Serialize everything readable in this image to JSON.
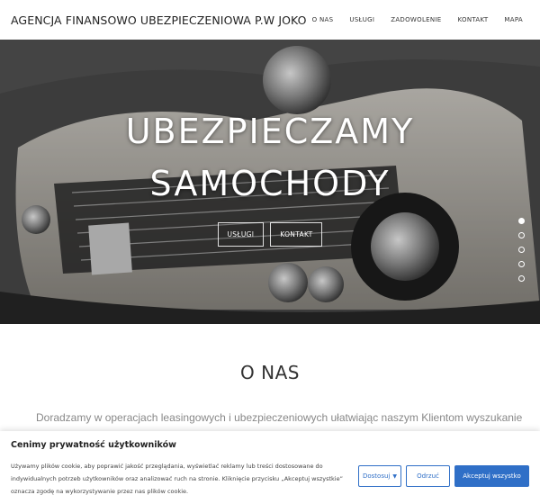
{
  "header": {
    "logo": "AGENCJA FINANSOWO UBEZPIECZENIOWA P.W JOKO",
    "nav": [
      {
        "label": "O NAS"
      },
      {
        "label": "USŁUGI"
      },
      {
        "label": "ZADOWOLENIE"
      },
      {
        "label": "KONTAKT"
      },
      {
        "label": "MAPA"
      }
    ]
  },
  "hero": {
    "title_line1": "UBEZPIECZAMY",
    "title_line2": "SAMOCHODY",
    "btn_services": "USŁUGI",
    "btn_contact": "KONTAKT",
    "slides_total": 5,
    "active_slide": 1
  },
  "about": {
    "title": "O NAS",
    "text": "Doradzamy w operacjach leasingowych i ubezpieczeniowych ułatwiając naszym Klientom wyszukanie najlepszych ofert i"
  },
  "cookie": {
    "title": "Cenimy prywatność użytkowników",
    "text": "Używamy plików cookie, aby poprawić jakość przeglądania, wyświetlać reklamy lub treści dostosowane do indywidualnych potrzeb użytkowników oraz analizować ruch na stronie. Kliknięcie przycisku „Akceptuj wszystkie” oznacza zgodę na wykorzystywanie przez nas plików cookie.",
    "customize": "Dostosuj",
    "reject": "Odrzuć",
    "accept": "Akceptuj wszystko",
    "accent": "#2f6fc7"
  }
}
